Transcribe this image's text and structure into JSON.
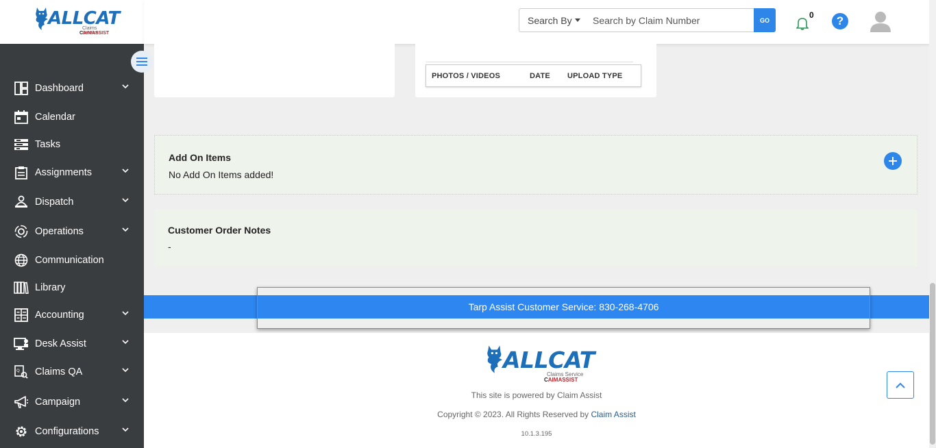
{
  "brand": {
    "name": "ALLCAT",
    "tagline": "Claims Service",
    "powered_by_prefix": "powered by",
    "powered_by_c": "C",
    "powered_by_rest": "AIMASSIST"
  },
  "header": {
    "search_by_label": "Search By",
    "search_placeholder": "Search by Claim Number",
    "go_label": "GO",
    "notification_count": "0",
    "help_label": "?"
  },
  "sidebar": {
    "items": [
      {
        "label": "Dashboard",
        "icon": "dashboard-icon",
        "has_submenu": true
      },
      {
        "label": "Calendar",
        "icon": "calendar-icon",
        "has_submenu": false
      },
      {
        "label": "Tasks",
        "icon": "tasks-icon",
        "has_submenu": false
      },
      {
        "label": "Assignments",
        "icon": "clipboard-icon",
        "has_submenu": true
      },
      {
        "label": "Dispatch",
        "icon": "dispatch-icon",
        "has_submenu": true
      },
      {
        "label": "Operations",
        "icon": "operations-icon",
        "has_submenu": true
      },
      {
        "label": "Communication",
        "icon": "globe-icon",
        "has_submenu": false
      },
      {
        "label": "Library",
        "icon": "library-icon",
        "has_submenu": false
      },
      {
        "label": "Accounting",
        "icon": "accounting-icon",
        "has_submenu": true
      },
      {
        "label": "Desk Assist",
        "icon": "desk-assist-icon",
        "has_submenu": true
      },
      {
        "label": "Claims QA",
        "icon": "claims-qa-icon",
        "has_submenu": true
      },
      {
        "label": "Campaign",
        "icon": "megaphone-icon",
        "has_submenu": true
      },
      {
        "label": "Configurations",
        "icon": "gear-icon",
        "has_submenu": true
      }
    ]
  },
  "media_table": {
    "columns": [
      "PHOTOS / VIDEOS",
      "DATE",
      "UPLOAD TYPE"
    ]
  },
  "addon": {
    "title": "Add On Items",
    "empty_message": "No Add On Items added!"
  },
  "notes": {
    "title": "Customer Order Notes",
    "value": "-"
  },
  "customer_service": {
    "text": "Tarp Assist Customer Service: 830-268-4706"
  },
  "footer": {
    "powered_text": "This site is powered by Claim Assist",
    "copyright_prefix": "Copyright © 2023. All Rights Reserved by",
    "copyright_link": "Claim Assist",
    "version": "10.1.3.195"
  },
  "colors": {
    "accent": "#2e87e8",
    "sidebar_bg": "#3a3d40",
    "panel_green": "#eef3ec",
    "brand_blue": "#1c6fb8",
    "brand_red": "#c0262d"
  }
}
